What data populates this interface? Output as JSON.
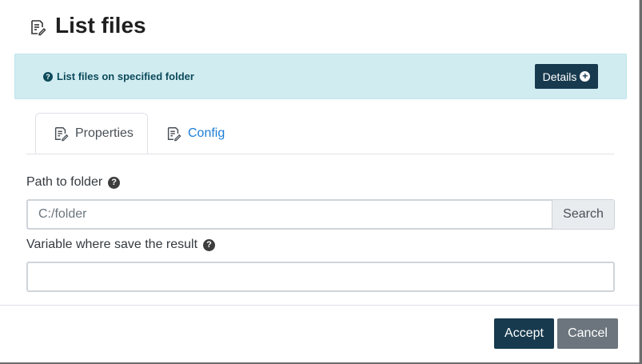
{
  "modal": {
    "title": "List files",
    "title_icon": "file-edit-icon"
  },
  "info": {
    "icon": "question-circle-icon",
    "text": "List files on specified folder",
    "details_label": "Details",
    "details_icon": "plus-circle-icon",
    "background_color": "#d1ecf1",
    "text_color": "#0c4a5a"
  },
  "tabs": [
    {
      "label": "Properties",
      "icon": "file-edit-icon",
      "active": true
    },
    {
      "label": "Config",
      "icon": "file-edit-icon",
      "active": false
    }
  ],
  "form": {
    "path_label": "Path to folder",
    "path_placeholder": "C:/folder",
    "path_value": "",
    "search_label": "Search",
    "variable_label": "Variable where save the result",
    "variable_value": ""
  },
  "footer": {
    "accept_label": "Accept",
    "cancel_label": "Cancel"
  },
  "colors": {
    "primary": "#173a4e",
    "secondary": "#6c757d",
    "link": "#1c7ed6"
  }
}
